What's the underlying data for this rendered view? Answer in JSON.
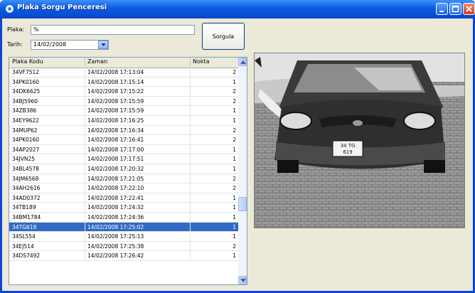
{
  "window": {
    "title": "Plaka Sorgu Penceresi",
    "accent": "#0a5ae0"
  },
  "form": {
    "plaka_label": "Plaka:",
    "plaka_value": "%",
    "tarih_label": "Tarih:",
    "tarih_value": "14/02/2008",
    "sorgula_label": "Sorgula"
  },
  "table": {
    "columns": [
      "Plaka Kodu",
      "Zaman",
      "Nokta"
    ],
    "rows": [
      [
        "34VF7512",
        "14/02/2008 17:13:04",
        "2"
      ],
      [
        "34PK0160",
        "14/02/2008 17:15:14",
        "1"
      ],
      [
        "34DK6625",
        "14/02/2008 17:15:22",
        "2"
      ],
      [
        "34BJ5960",
        "14/02/2008 17:15:59",
        "2"
      ],
      [
        "34ZB386",
        "14/02/2008 17:15:59",
        "1"
      ],
      [
        "34EY9622",
        "14/02/2008 17:16:25",
        "1"
      ],
      [
        "34MUP62",
        "14/02/2008 17:16:34",
        "2"
      ],
      [
        "34PK0160",
        "14/02/2008 17:16:41",
        "2"
      ],
      [
        "34AP2027",
        "14/02/2008 17:17:00",
        "1"
      ],
      [
        "34JVN25",
        "14/02/2008 17:17:51",
        "1"
      ],
      [
        "34BL4578",
        "14/02/2008 17:20:32",
        "1"
      ],
      [
        "34JM6568",
        "14/02/2008 17:21:05",
        "2"
      ],
      [
        "34AH2616",
        "14/02/2008 17:22:10",
        "2"
      ],
      [
        "34AD0372",
        "14/02/2008 17:22:41",
        "1"
      ],
      [
        "34TB189",
        "14/02/2008 17:24:32",
        "1"
      ],
      [
        "34BM1784",
        "14/02/2008 17:24:36",
        "1"
      ],
      [
        "34TG619",
        "14/02/2008 17:25:02",
        "1"
      ],
      [
        "34SL554",
        "14/02/2008 17:25:13",
        "1"
      ],
      [
        "34EJ514",
        "14/02/2008 17:25:38",
        "2"
      ],
      [
        "34DS7492",
        "14/02/2008 17:26:42",
        "1"
      ]
    ],
    "selected_index": 16,
    "selection_color": "#316ac5"
  },
  "photo": {
    "plate_text_top": "34 TG",
    "plate_text_bottom": "619"
  },
  "icons": [
    "app-icon",
    "minimize-icon",
    "maximize-icon",
    "close-icon",
    "dropdown-arrow-icon",
    "scroll-up-icon",
    "scroll-down-icon"
  ]
}
